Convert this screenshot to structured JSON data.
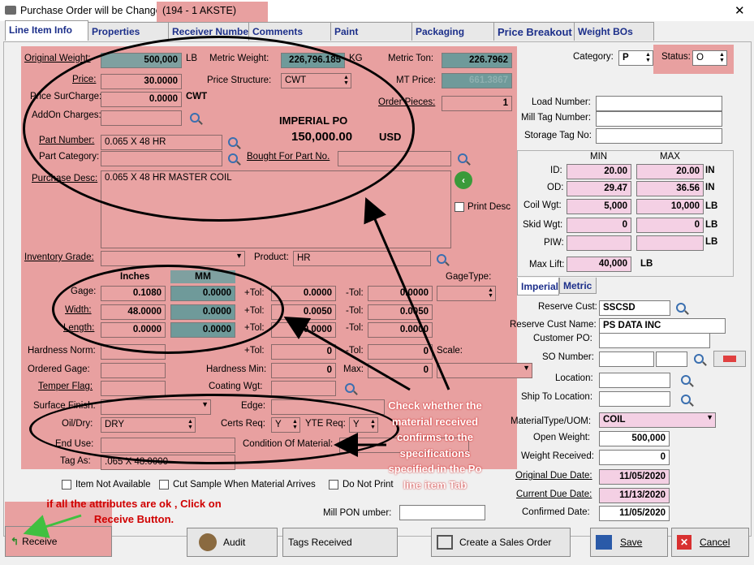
{
  "window": {
    "title": "Purchase Order will be Changed",
    "title_suffix": "(194 - 1  AKSTE)",
    "close": "✕"
  },
  "tabs": [
    "Line Item Info",
    "Properties",
    "Receiver Numbers",
    "Comments",
    "Paint",
    "Packaging",
    "Price Breakout",
    "Weight BOs"
  ],
  "labels": {
    "original_weight": "Original Weight:",
    "lb": "LB",
    "metric_weight": "Metric Weight:",
    "kg": "KG",
    "metric_ton": "Metric Ton:",
    "price": "Price:",
    "price_structure": "Price Structure:",
    "mt_price": "MT Price:",
    "price_surcharge": "Price SurCharge:",
    "cwt": "CWT",
    "order_pieces": "Order Pieces:",
    "addon_charges": "AddOn Charges:",
    "imperial_po": "IMPERIAL PO",
    "usd": "USD",
    "part_number": "Part Number:",
    "part_category": "Part Category:",
    "bought_for": "Bought For Part No.",
    "purchase_desc": "Purchase Desc:",
    "print_desc": "Print Desc",
    "inventory_grade": "Inventory Grade:",
    "product": "Product:",
    "inches": "Inches",
    "mm": "MM",
    "gage_type": "GageType:",
    "gage": "Gage:",
    "width": "Width:",
    "length": "Length:",
    "plus_tol": "+Tol:",
    "minus_tol": "-Tol:",
    "hardness_norm": "Hardness Norm:",
    "scale": "Scale:",
    "ordered_gage": "Ordered Gage:",
    "hardness_min": "Hardness Min:",
    "max": "Max:",
    "temper_flag": "Temper Flag:",
    "coating_wgt": "Coating Wgt:",
    "surface_finish": "Surface Finish:",
    "edge": "Edge:",
    "oil_dry": "Oil/Dry:",
    "certs_req": "Certs Req:",
    "yte_req": "YTE Req:",
    "end_use": "End Use:",
    "condition": "Condition Of Material:",
    "tag_as": "Tag As:",
    "item_not_available": "Item Not Available",
    "cut_sample": "Cut Sample When Material Arrives",
    "do_not_print": "Do Not Print",
    "mill_pon": "Mill PON umber:",
    "category": "Category:",
    "status": "Status:",
    "load_number": "Load Number:",
    "mill_tag_number": "Mill Tag Number:",
    "storage_tag_no": "Storage Tag No:",
    "min": "MIN",
    "max_h": "MAX",
    "id": "ID:",
    "od": "OD:",
    "coil_wgt": "Coil Wgt:",
    "skid_wgt": "Skid Wgt:",
    "piw": "PIW:",
    "max_lift": "Max Lift:",
    "in": "IN",
    "imperial": "Imperial",
    "metric": "Metric",
    "reserve_cust": "Reserve Cust:",
    "reserve_cust_name": "Reserve Cust Name:",
    "customer_po": "Customer PO:",
    "so_number": "SO Number:",
    "location": "Location:",
    "ship_to_location": "Ship To Location:",
    "material_type": "MaterialType/UOM:",
    "open_weight": "Open Weight:",
    "weight_received": "Weight Received:",
    "original_due": "Original Due Date:",
    "current_due": "Current Due Date:",
    "confirmed_date": "Confirmed Date:"
  },
  "values": {
    "original_weight": "500,000",
    "metric_weight": "226,796.185",
    "metric_ton": "226.7962",
    "price": "30.0000",
    "price_structure": "CWT",
    "mt_price": "661.3867",
    "price_surcharge": "0.0000",
    "order_pieces": "1",
    "po_amount": "150,000.00",
    "part_number": "0.065 X 48 HR",
    "purchase_desc": "0.065 X 48 HR MASTER COIL",
    "product": "HR",
    "gage_in": "0.1080",
    "gage_mm": "0.0000",
    "gage_ptol": "0.0000",
    "gage_mtol": "0.0000",
    "width_in": "48.0000",
    "width_mm": "0.0000",
    "width_ptol": "0.0050",
    "width_mtol": "0.0050",
    "length_in": "0.0000",
    "length_mm": "0.0000",
    "length_ptol": "0.0000",
    "length_mtol": "0.0000",
    "hn_ptol": "0",
    "hn_mtol": "0",
    "hmin": "0",
    "hmax": "0",
    "oil_dry": "DRY",
    "certs_req": "Y",
    "yte_req": "Y",
    "tag_as": ".065 X 48.0000",
    "category": "P",
    "status": "O",
    "id_min": "20.00",
    "id_max": "20.00",
    "od_min": "29.47",
    "od_max": "36.56",
    "coil_min": "5,000",
    "coil_max": "10,000",
    "skid_min": "0",
    "skid_max": "0",
    "max_lift": "40,000",
    "reserve_cust": "SSCSD",
    "reserve_cust_name": "PS DATA INC",
    "material_type": "COIL",
    "open_weight": "500,000",
    "weight_received": "0",
    "original_due": "11/05/2020",
    "current_due": "11/13/2020",
    "confirmed_date": "11/05/2020"
  },
  "annotations": {
    "check_note": "Check whether the material received confirms to the specifications specified in the Po line item Tab",
    "receive_note": "if all the attributes are ok , Click on Receive Button."
  },
  "buttons": {
    "receive": "Receive",
    "audit": "Audit",
    "tags_received": "Tags Received",
    "create_sales_order": "Create a Sales Order",
    "save": "Save",
    "cancel": "Cancel"
  }
}
